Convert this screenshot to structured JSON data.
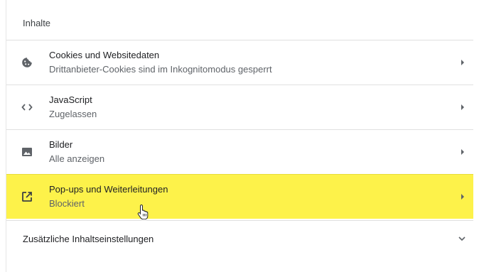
{
  "section": {
    "title": "Inhalte"
  },
  "rows": [
    {
      "title": "Cookies und Websitedaten",
      "subtitle": "Drittanbieter-Cookies sind im Inkognitomodus gesperrt",
      "icon": "cookie-icon"
    },
    {
      "title": "JavaScript",
      "subtitle": "Zugelassen",
      "icon": "code-icon"
    },
    {
      "title": "Bilder",
      "subtitle": "Alle anzeigen",
      "icon": "image-icon"
    },
    {
      "title": "Pop-ups und Weiterleitungen",
      "subtitle": "Blockiert",
      "icon": "open-in-new-icon",
      "highlighted": true
    }
  ],
  "additional": {
    "label": "Zusätzliche Inhaltseinstellungen",
    "icon": "chevron-down-icon"
  },
  "colors": {
    "highlight": "#fdf24a",
    "text_primary": "#202124",
    "text_secondary": "#5f6368",
    "divider": "#e0e0e0"
  },
  "cursor": {
    "icon": "hand-pointer-icon"
  }
}
